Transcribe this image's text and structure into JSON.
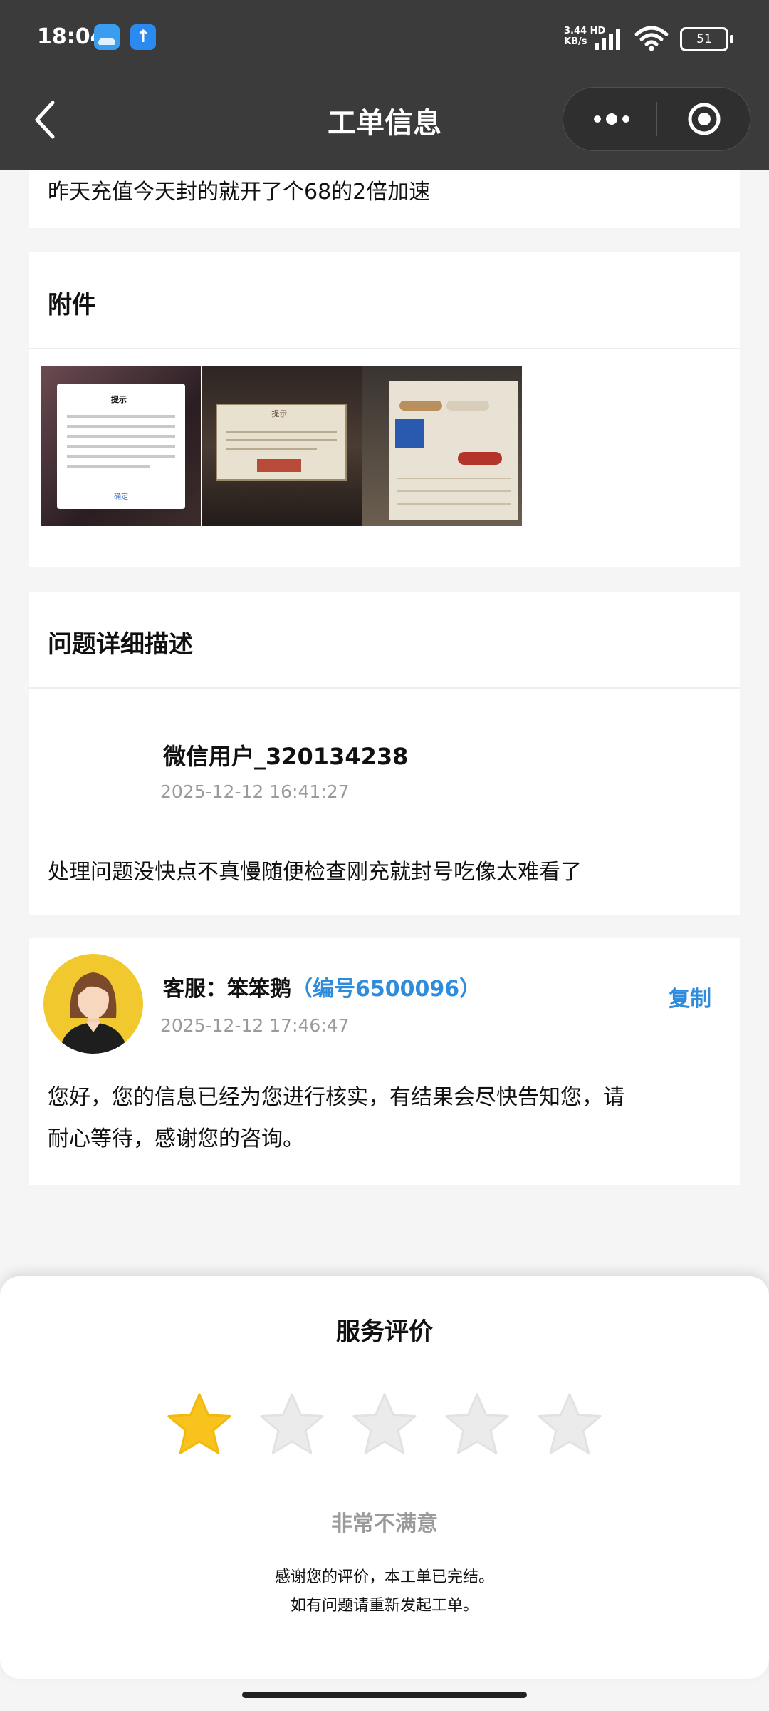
{
  "status_bar": {
    "time": "18:04",
    "net_speed_value": "3.44",
    "net_speed_unit": "KB/s",
    "net_type": "HD",
    "battery": "51"
  },
  "header": {
    "title": "工单信息"
  },
  "top_card": {
    "text": "昨天充值今天封的就开了个68的2倍加速"
  },
  "attachments": {
    "title": "附件",
    "images": [
      {
        "alt": "提示 dialog screenshot",
        "heading": "提示",
        "button": "确定"
      },
      {
        "alt": "warning dialog screenshot",
        "heading": "提示"
      },
      {
        "alt": "character info screenshot"
      }
    ]
  },
  "problem": {
    "title": "问题详细描述",
    "user_name": "微信用户_320134238",
    "timestamp": "2025-12-12 16:41:27",
    "description": "处理问题没快点不真慢随便检查刚充就封号吃像太难看了"
  },
  "reply": {
    "agent_label": "客服：",
    "agent_name": "笨笨鹅",
    "agent_id": "（编号6500096）",
    "copy_label": "复制",
    "timestamp": "2025-12-12 17:46:47",
    "message_line1": "您好，您的信息已经为您进行核实，有结果会尽快告知您，请",
    "message_line2": "耐心等待，感谢您的咨询。"
  },
  "rating": {
    "title": "服务评价",
    "stars_total": 5,
    "stars_selected": 1,
    "result_text": "非常不满意",
    "thanks_line1": "感谢您的评价，本工单已完结。",
    "thanks_line2": "如有问题请重新发起工单。"
  },
  "colors": {
    "header_bg": "#3b3b3b",
    "accent_blue": "#2f8cdc",
    "star_selected": "#f7c31c",
    "star_unselected": "#e8e8e8"
  }
}
